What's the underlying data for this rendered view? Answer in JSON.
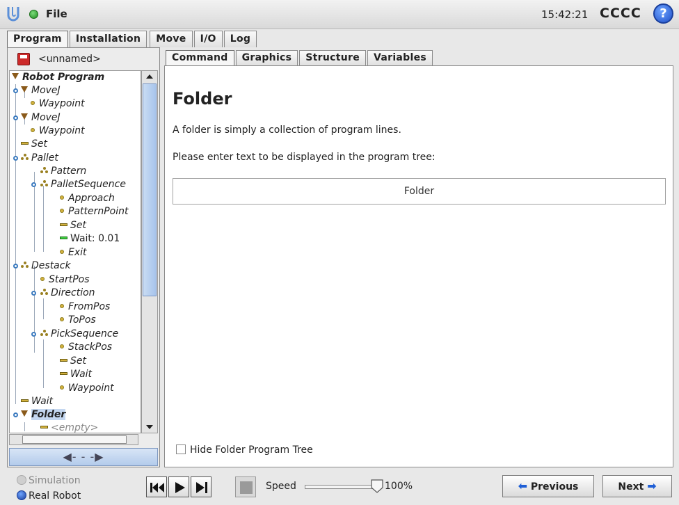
{
  "topbar": {
    "menu_label": "File",
    "clock": "15:42:21",
    "robot_name": "CCCC",
    "help_glyph": "?"
  },
  "main_tabs": [
    {
      "label": "Program",
      "active": true
    },
    {
      "label": "Installation",
      "active": false
    },
    {
      "label": "Move",
      "active": false
    },
    {
      "label": "I/O",
      "active": false
    },
    {
      "label": "Log",
      "active": false
    }
  ],
  "left_panel": {
    "program_name": "<unnamed>",
    "tree": [
      {
        "label": "Robot Program",
        "icon": "folder-triangle-icon"
      },
      {
        "label": "MoveJ",
        "icon": "folder-triangle-icon"
      },
      {
        "label": "Waypoint",
        "icon": "waypoint-dot-icon"
      },
      {
        "label": "MoveJ",
        "icon": "folder-triangle-icon"
      },
      {
        "label": "Waypoint",
        "icon": "waypoint-dot-icon"
      },
      {
        "label": "Set",
        "icon": "command-bar-icon"
      },
      {
        "label": "Pallet",
        "icon": "pallet-icon"
      },
      {
        "label": "Pattern",
        "icon": "pallet-icon"
      },
      {
        "label": "PalletSequence",
        "icon": "pallet-icon"
      },
      {
        "label": "Approach",
        "icon": "waypoint-dot-icon"
      },
      {
        "label": "PatternPoint",
        "icon": "waypoint-dot-icon"
      },
      {
        "label": "Set",
        "icon": "command-bar-icon"
      },
      {
        "label": "Wait: 0.01",
        "icon": "wait-active-bar-icon"
      },
      {
        "label": "Exit",
        "icon": "waypoint-dot-icon"
      },
      {
        "label": "Destack",
        "icon": "pallet-icon"
      },
      {
        "label": "StartPos",
        "icon": "waypoint-dot-icon"
      },
      {
        "label": "Direction",
        "icon": "pallet-icon"
      },
      {
        "label": "FromPos",
        "icon": "waypoint-dot-icon"
      },
      {
        "label": "ToPos",
        "icon": "waypoint-dot-icon"
      },
      {
        "label": "PickSequence",
        "icon": "pallet-icon"
      },
      {
        "label": "StackPos",
        "icon": "waypoint-dot-icon"
      },
      {
        "label": "Set",
        "icon": "command-bar-icon"
      },
      {
        "label": "Wait",
        "icon": "command-bar-icon"
      },
      {
        "label": "Waypoint",
        "icon": "waypoint-dot-icon"
      },
      {
        "label": "Wait",
        "icon": "command-bar-icon"
      },
      {
        "label": "Folder",
        "icon": "folder-triangle-icon"
      },
      {
        "label": "<empty>",
        "icon": "command-bar-icon"
      }
    ]
  },
  "sub_tabs": [
    {
      "label": "Command",
      "active": true
    },
    {
      "label": "Graphics",
      "active": false
    },
    {
      "label": "Structure",
      "active": false
    },
    {
      "label": "Variables",
      "active": false
    }
  ],
  "command": {
    "heading": "Folder",
    "description": "A folder is simply a collection of program lines.",
    "prompt": "Please enter text to be displayed in the program tree:",
    "folder_name_value": "Folder",
    "hide_tree_label": "Hide Folder Program Tree",
    "hide_tree_checked": false
  },
  "bottombar": {
    "simulation_label": "Simulation",
    "real_robot_label": "Real Robot",
    "speed_label": "Speed",
    "speed_value": "100%",
    "speed_fraction": 1.0,
    "previous_label": "Previous",
    "next_label": "Next"
  },
  "colors": {
    "accent": "#1f5fd6",
    "selection": "#c4d7f0",
    "waypoint": "#d4b23e",
    "wait_active": "#3ecf3e"
  }
}
